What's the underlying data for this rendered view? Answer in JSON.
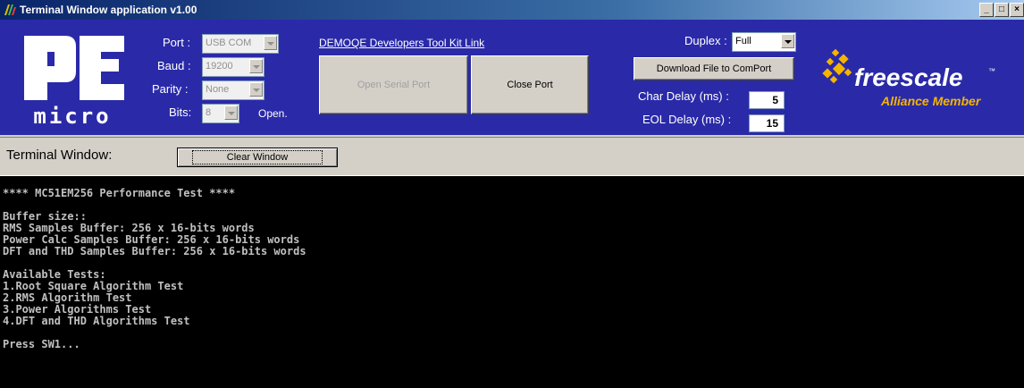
{
  "window": {
    "title": "Terminal Window application v1.00",
    "min_label": "_",
    "max_label": "□",
    "close_label": "×"
  },
  "logos": {
    "pe_text": "PE",
    "micro_text": "micro",
    "freescale_text": "freescale",
    "freescale_tm": "™",
    "alliance_text": "Alliance Member"
  },
  "serial": {
    "port_label": "Port :",
    "port_value": "USB COM",
    "baud_label": "Baud :",
    "baud_value": "19200",
    "parity_label": "Parity :",
    "parity_value": "None",
    "bits_label": "Bits:",
    "bits_value": "8",
    "status": "Open."
  },
  "link_text": "DEMOQE Developers Tool Kit Link",
  "buttons": {
    "open_port": "Open Serial Port",
    "close_port": "Close Port",
    "download": "Download File to ComPort",
    "clear": "Clear Window"
  },
  "duplex": {
    "label": "Duplex :",
    "value": "Full"
  },
  "delays": {
    "char_label": "Char Delay (ms) :",
    "char_value": "5",
    "eol_label": "EOL Delay (ms) :",
    "eol_value": "15"
  },
  "terminal": {
    "label": "Terminal Window:",
    "lines": [
      "**** MC51EM256 Performance Test ****",
      "",
      "Buffer size::",
      "RMS Samples Buffer: 256 x 16-bits words",
      "Power Calc Samples Buffer: 256 x 16-bits words",
      "DFT and THD Samples Buffer: 256 x 16-bits words",
      "",
      "Available Tests:",
      "1.Root Square Algorithm Test",
      "2.RMS Algorithm Test",
      "3.Power Algorithms Test",
      "4.DFT and THD Algorithms Test",
      "",
      "Press SW1..."
    ]
  }
}
